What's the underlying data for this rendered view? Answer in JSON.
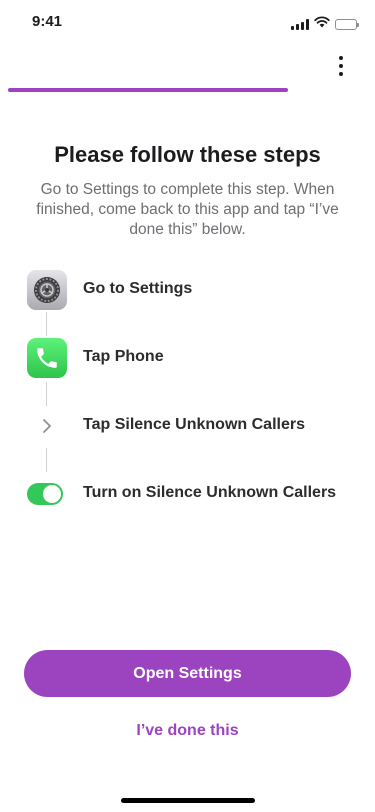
{
  "status_bar": {
    "time": "9:41",
    "icons": [
      "cellular-signal-icon",
      "wifi-icon",
      "battery-icon"
    ]
  },
  "header": {
    "more_icon": "vertical-ellipsis-icon",
    "progress": 0.78,
    "accent_color": "#9c44c0"
  },
  "main": {
    "title": "Please follow these steps",
    "subtitle": "Go to Settings to complete this step. When finished, come back to this app and tap “I’ve done this” below.",
    "steps": [
      {
        "label": "Go to Settings",
        "icon": "settings-icon"
      },
      {
        "label": "Tap Phone",
        "icon": "phone-icon"
      },
      {
        "label": "Tap Silence Unknown Callers",
        "icon": "chevron-right-icon"
      },
      {
        "label": "Turn on Silence Unknown Callers",
        "icon": "toggle-on-icon"
      }
    ]
  },
  "actions": {
    "primary_label": "Open Settings",
    "secondary_label": "I’ve done this"
  }
}
